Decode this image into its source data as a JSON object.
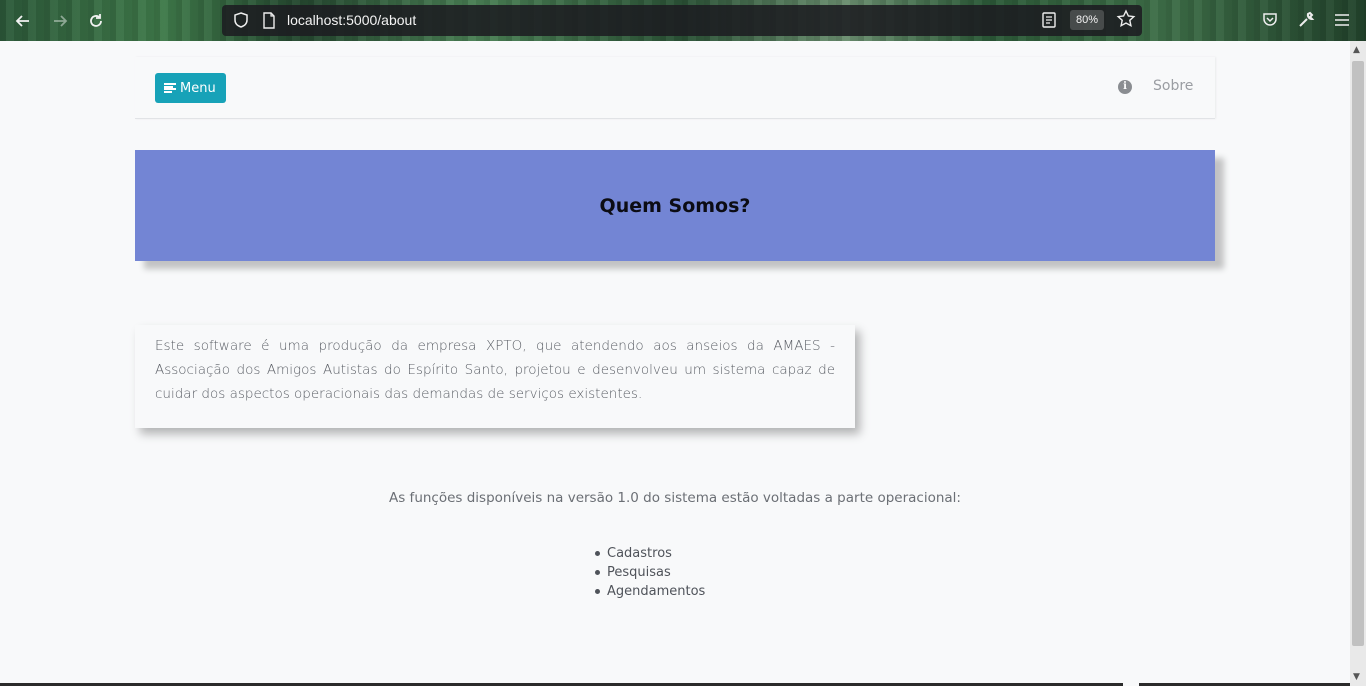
{
  "browser": {
    "url": "localhost:5000/about",
    "zoom": "80%"
  },
  "navbar": {
    "menu_label": "Menu",
    "about_link": "Sobre"
  },
  "hero": {
    "title": "Quem Somos?"
  },
  "about": {
    "text": "Este software é uma produção da empresa XPTO, que atendendo aos anseios da AMAES - Associação dos Amigos Autistas do Espírito Santo, projetou e desenvolveu um sistema capaz de cuidar dos aspectos operacionais das demandas de serviços existentes."
  },
  "functions": {
    "intro": "As funções disponíveis na versão 1.0 do sistema estão voltadas a parte operacional:",
    "items": [
      "Cadastros",
      "Pesquisas",
      "Agendamentos"
    ]
  },
  "colors": {
    "menu_button": "#17a2b8",
    "hero_background": "#7385d4"
  }
}
